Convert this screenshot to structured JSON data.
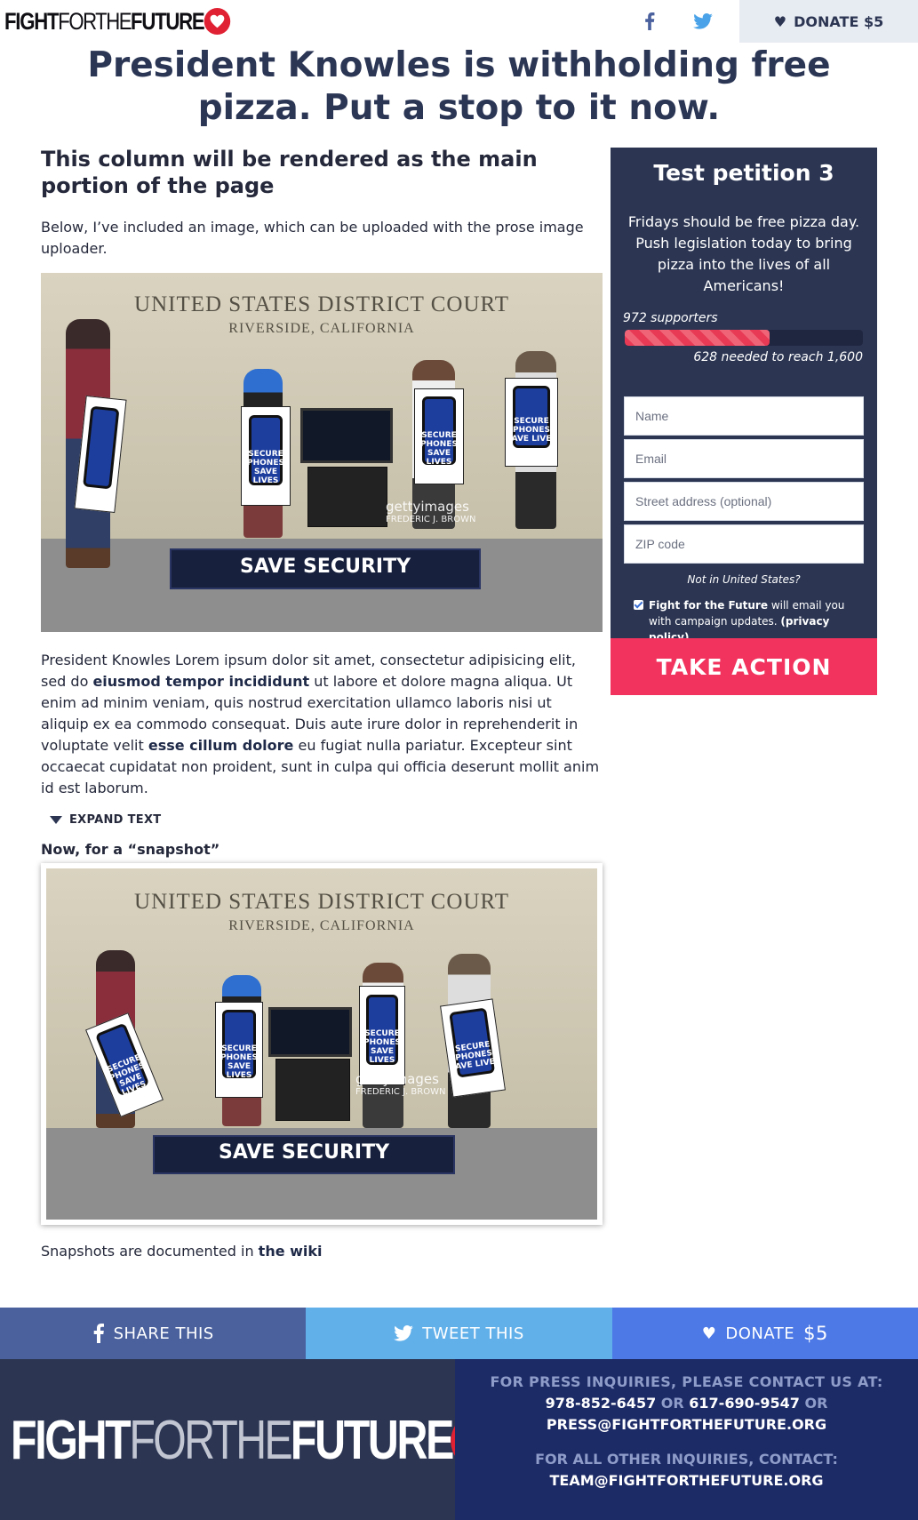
{
  "header": {
    "logo_text_bold1": "FIGHT",
    "logo_text_thin": "FORTHE",
    "logo_text_bold2": "FUTURE",
    "facebook_icon": "facebook-icon",
    "twitter_icon": "twitter-icon",
    "donate_label": "DONATE $5"
  },
  "headline": "President Knowles is withholding free pizza. Put a stop to it now.",
  "main": {
    "title": "This column will be rendered as the main portion of the page",
    "intro": "Below, I’ve included an image, which can be uploaded with the prose image uploader.",
    "photo": {
      "sign_line1": "UNITED STATES DISTRICT COURT",
      "sign_line2": "RIVERSIDE, CALIFORNIA",
      "poster_text": "SECURE PHONES SAVE LIVES",
      "mat_text": "SAVE SECURITY",
      "watermark": "gettyimages",
      "credit": "FREDERIC J. BROWN"
    },
    "body": {
      "p1": "President Knowles Lorem ipsum dolor sit amet, consectetur adipisicing elit, sed do ",
      "b1": "eiusmod tempor incididunt",
      "p2": " ut labore et dolore magna aliqua. Ut enim ad minim veniam, quis nostrud exercitation ullamco laboris nisi ut aliquip ex ea commodo consequat. Duis aute irure dolor in reprehenderit in voluptate velit ",
      "b2": "esse cillum dolore",
      "p3": " eu fugiat nulla pariatur. Excepteur sint occaecat cupidatat non proident, sunt in culpa qui officia deserunt mollit anim id est laborum."
    },
    "expand_label": "EXPAND TEXT",
    "snapshot_label": "Now, for a “snapshot”",
    "snapshot_caption_prefix": "Snapshots are documented in ",
    "snapshot_caption_link": "the wiki"
  },
  "petition": {
    "title": "Test petition 3",
    "description": "Fridays should be free pizza day. Push legislation today to bring pizza into the lives of all Americans!",
    "supporters_text": "972 supporters",
    "needed_text": "628 needed to reach 1,600",
    "progress": 0.6075,
    "fields": {
      "name": "Name",
      "email": "Email",
      "street": "Street address (optional)",
      "zip": "ZIP code"
    },
    "not_us": "Not in United States?",
    "optin_org": "Fight for the Future",
    "optin_text": " will email you with campaign updates. ",
    "optin_link": "(privacy policy)",
    "submit_label": "TAKE ACTION"
  },
  "sharebar": {
    "share_label": "SHARE THIS",
    "tweet_label": "TWEET THIS",
    "donate_label": "DONATE",
    "donate_amount": "$5"
  },
  "footer": {
    "logo_bold1": "FIGHT",
    "logo_thin": "FORTHE",
    "logo_bold2": "FUTURE",
    "press_title": "FOR PRESS INQUIRIES, PLEASE CONTACT US AT:",
    "phone1": "978-852-6457",
    "or": "OR",
    "phone2": "617-690-9547",
    "press_email": "PRESS@FIGHTFORTHEFUTURE.ORG",
    "other_title": "FOR ALL OTHER INQUIRIES, CONTACT:",
    "other_email": "TEAM@FIGHTFORTHEFUTURE.ORG"
  },
  "colors": {
    "navy": "#2c3653",
    "accent_red": "#f2335e",
    "facebook": "#4a619e",
    "twitter": "#62b0ea",
    "donate": "#4c79e6",
    "footer_right": "#1c2a66"
  }
}
